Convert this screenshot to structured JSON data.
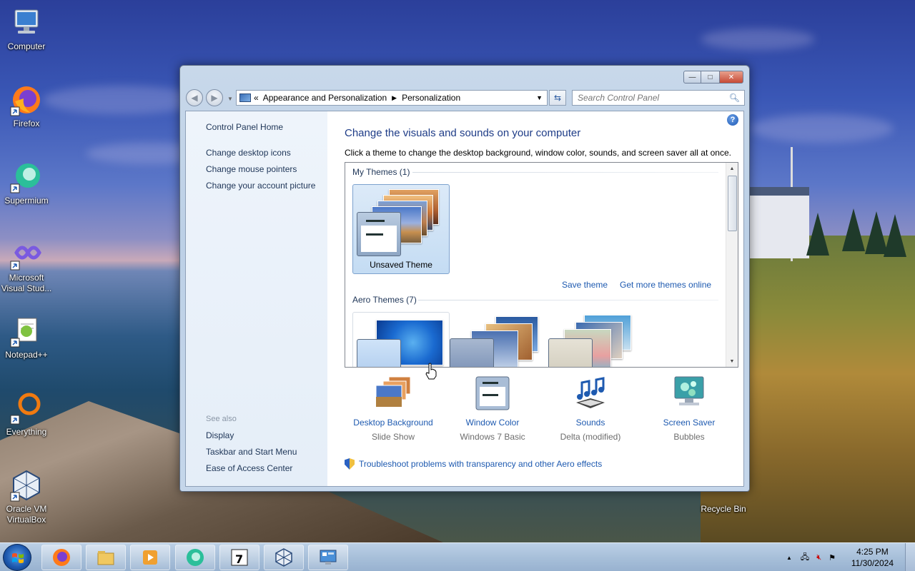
{
  "desktop": {
    "icons": [
      {
        "label": "Computer",
        "icon": "computer-icon"
      },
      {
        "label": "Firefox",
        "icon": "firefox-icon"
      },
      {
        "label": "Supermium",
        "icon": "supermium-icon"
      },
      {
        "label": "Microsoft Visual Stud...",
        "icon": "visual-studio-icon"
      },
      {
        "label": "Notepad++",
        "icon": "notepadpp-icon"
      },
      {
        "label": "Everything",
        "icon": "everything-icon"
      },
      {
        "label": "Oracle VM VirtualBox",
        "icon": "virtualbox-icon"
      }
    ],
    "recycle_bin_label": "Recycle Bin"
  },
  "window": {
    "address": {
      "overflow": "«",
      "crumbs": [
        "Appearance and Personalization",
        "Personalization"
      ]
    },
    "search_placeholder": "Search Control Panel",
    "left_pane": {
      "home": "Control Panel Home",
      "links": [
        "Change desktop icons",
        "Change mouse pointers",
        "Change your account picture"
      ],
      "see_also_label": "See also",
      "see_also": [
        "Display",
        "Taskbar and Start Menu",
        "Ease of Access Center"
      ]
    },
    "main": {
      "title": "Change the visuals and sounds on your computer",
      "description": "Click a theme to change the desktop background, window color, sounds, and screen saver all at once.",
      "my_themes_header": "My Themes (1)",
      "my_theme_label": "Unsaved Theme",
      "save_theme": "Save theme",
      "get_more": "Get more themes online",
      "aero_header": "Aero Themes (7)"
    },
    "bottom": [
      {
        "title": "Desktop Background",
        "sub": "Slide Show",
        "icon": "desktop-background-icon"
      },
      {
        "title": "Window Color",
        "sub": "Windows 7 Basic",
        "icon": "window-color-icon"
      },
      {
        "title": "Sounds",
        "sub": "Delta (modified)",
        "icon": "sounds-icon"
      },
      {
        "title": "Screen Saver",
        "sub": "Bubbles",
        "icon": "screen-saver-icon"
      }
    ],
    "troubleshoot": "Troubleshoot problems with transparency and other Aero effects"
  },
  "taskbar": {
    "apps": [
      "firefox",
      "file-explorer",
      "media-player",
      "supermium",
      "7zip",
      "virtualbox",
      "control-panel"
    ],
    "clock": {
      "time": "4:25 PM",
      "date": "11/30/2024"
    }
  }
}
